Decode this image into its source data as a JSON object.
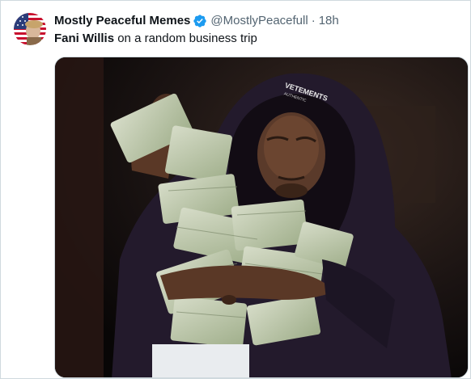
{
  "tweet": {
    "display_name": "Mostly Peaceful Memes",
    "handle": "@MostlyPeacefull",
    "separator": "·",
    "time": "18h",
    "text_bold": "Fani Willis",
    "text_rest": " on a random business trip"
  },
  "media": {
    "hoodie_logo_line1": "VETEMENTS",
    "hoodie_logo_line2": "AUTHENTIC",
    "description_icon": "photo-man-hugging-cash"
  },
  "colors": {
    "verified_blue": "#1d9bf0",
    "secondary_text": "#536471",
    "hoodie": "#231a2c",
    "cash_green": "#b9c7a6"
  }
}
